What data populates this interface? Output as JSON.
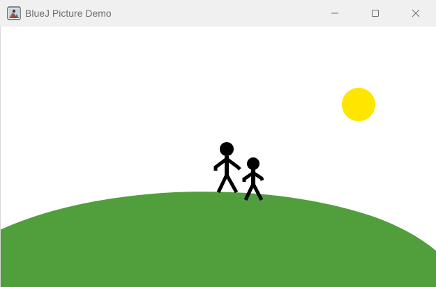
{
  "window": {
    "title": "BlueJ Picture Demo",
    "controls": {
      "minimize_icon": "minimize-icon",
      "maximize_icon": "maximize-icon",
      "close_icon": "close-icon"
    }
  },
  "scene": {
    "sky_color": "#ffffff",
    "sun_color": "#ffe600",
    "hill_color": "#519f3c",
    "figure_color": "#000000",
    "figures": [
      "tall-stick-person",
      "short-stick-person"
    ]
  }
}
